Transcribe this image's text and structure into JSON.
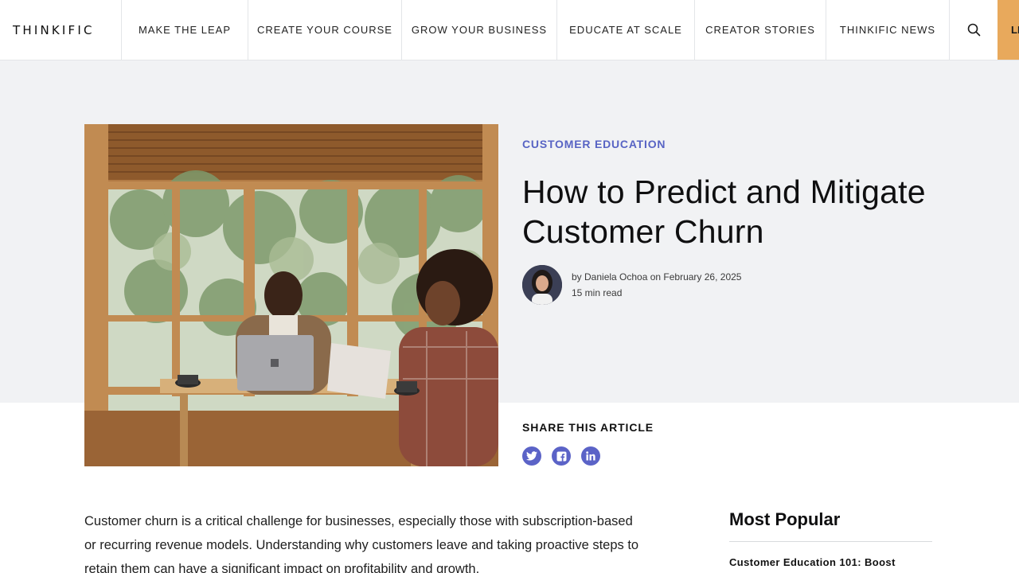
{
  "header": {
    "logo": "THINKIFIC",
    "nav": [
      "MAKE THE LEAP",
      "CREATE YOUR COURSE",
      "GROW YOUR BUSINESS",
      "EDUCATE AT SCALE",
      "CREATOR STORIES",
      "THINKIFIC NEWS"
    ],
    "search_icon": "search-icon",
    "cta_label": "LE",
    "cta_color": "#e8a95c"
  },
  "article": {
    "category": "CUSTOMER EDUCATION",
    "title": "How to Predict and Mitigate Customer Churn",
    "byline": "by Daniela Ochoa on February 26, 2025",
    "read_time": "15 min read",
    "accent_color": "#5864c4",
    "share": {
      "title": "SHARE THIS ARTICLE",
      "icons": [
        "twitter-icon",
        "facebook-icon",
        "linkedin-icon"
      ]
    },
    "intro": "Customer churn is a critical challenge for businesses, especially those with subscription-based or recurring revenue models. Understanding why customers leave and taking proactive steps to retain them can have a significant impact on profitability and growth."
  },
  "sidebar": {
    "popular_title": "Most Popular",
    "items": [
      "Customer Education 101: Boost"
    ]
  }
}
